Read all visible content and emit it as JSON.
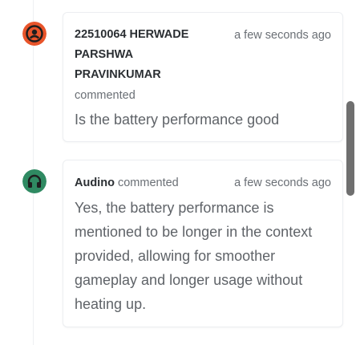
{
  "comments": [
    {
      "author_lines": [
        "22510064 HERWADE",
        "PARSHWA",
        "PRAVINKUMAR"
      ],
      "action": "commented",
      "time": "a few seconds ago",
      "body": "Is the battery performance good",
      "avatar_icon": "user-avatar-icon",
      "avatar_color": "#e8542a"
    },
    {
      "author": "Audino",
      "action": "commented",
      "time": "a few seconds ago",
      "body": "Yes, the battery performance is mentioned to be longer in the context provided, allowing for smoother gameplay and longer usage without heating up.",
      "avatar_icon": "headphones-icon",
      "avatar_color": "#2f8a62"
    }
  ]
}
